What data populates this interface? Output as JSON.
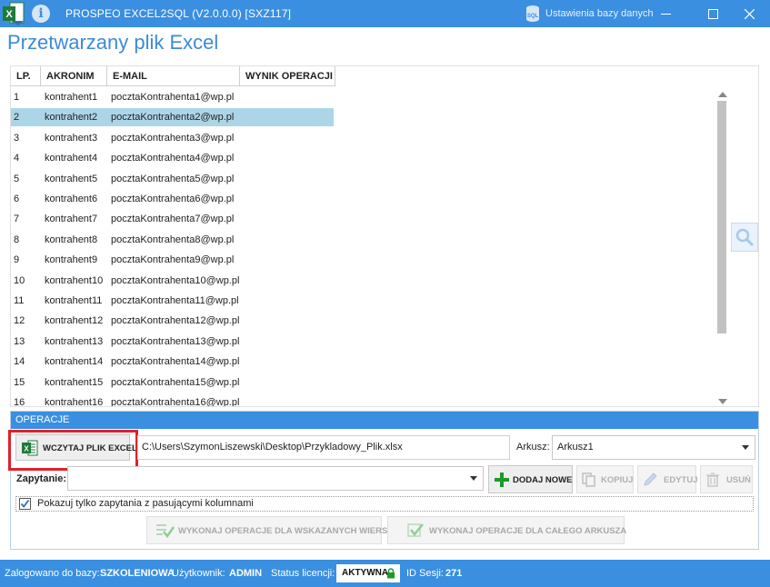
{
  "titlebar": {
    "title": "PROSPEO EXCEL2SQL (V2.0.0.0) [SXZ117]",
    "db_settings": "Ustawienia bazy danych",
    "accent": "#3a8fe0"
  },
  "page_title": "Przetwarzany plik Excel",
  "grid": {
    "columns": [
      "LP.",
      "AKRONIM",
      "E-MAIL",
      "WYNIK OPERACJI"
    ],
    "selected_row": 2,
    "selection_color": "#acd6e8",
    "rows": [
      {
        "lp": "1",
        "akronim": "kontrahent1",
        "email": "pocztaKontrahenta1@wp.pl",
        "wynik": ""
      },
      {
        "lp": "2",
        "akronim": "kontrahent2",
        "email": "pocztaKontrahenta2@wp.pl",
        "wynik": ""
      },
      {
        "lp": "3",
        "akronim": "kontrahent3",
        "email": "pocztaKontrahenta3@wp.pl",
        "wynik": ""
      },
      {
        "lp": "4",
        "akronim": "kontrahent4",
        "email": "pocztaKontrahenta4@wp.pl",
        "wynik": ""
      },
      {
        "lp": "5",
        "akronim": "kontrahent5",
        "email": "pocztaKontrahenta5@wp.pl",
        "wynik": ""
      },
      {
        "lp": "6",
        "akronim": "kontrahent6",
        "email": "pocztaKontrahenta6@wp.pl",
        "wynik": ""
      },
      {
        "lp": "7",
        "akronim": "kontrahent7",
        "email": "pocztaKontrahenta7@wp.pl",
        "wynik": ""
      },
      {
        "lp": "8",
        "akronim": "kontrahent8",
        "email": "pocztaKontrahenta8@wp.pl",
        "wynik": ""
      },
      {
        "lp": "9",
        "akronim": "kontrahent9",
        "email": "pocztaKontrahenta9@wp.pl",
        "wynik": ""
      },
      {
        "lp": "10",
        "akronim": "kontrahent10",
        "email": "pocztaKontrahenta10@wp.pl",
        "wynik": ""
      },
      {
        "lp": "11",
        "akronim": "kontrahent11",
        "email": "pocztaKontrahenta11@wp.pl",
        "wynik": ""
      },
      {
        "lp": "12",
        "akronim": "kontrahent12",
        "email": "pocztaKontrahenta12@wp.pl",
        "wynik": ""
      },
      {
        "lp": "13",
        "akronim": "kontrahent13",
        "email": "pocztaKontrahenta13@wp.pl",
        "wynik": ""
      },
      {
        "lp": "14",
        "akronim": "kontrahent14",
        "email": "pocztaKontrahenta14@wp.pl",
        "wynik": ""
      },
      {
        "lp": "15",
        "akronim": "kontrahent15",
        "email": "pocztaKontrahenta15@wp.pl",
        "wynik": ""
      },
      {
        "lp": "16",
        "akronim": "kontrahent16",
        "email": "pocztaKontrahenta16@wp.pl",
        "wynik": ""
      }
    ]
  },
  "operations": {
    "header": "OPERACJE",
    "load_excel_label": "WCZYTAJ PLIK EXCEL",
    "file_path": "C:\\Users\\SzymonLiszewski\\Desktop\\Przykladowy_Plik.xlsx",
    "sheet_label": "Arkusz:",
    "sheet_value": "Arkusz1",
    "query_label": "Zapytanie:",
    "query_value": "",
    "add_new_label": "DODAJ NOWE",
    "copy_label": "KOPIUJ",
    "edit_label": "EDYTUJ",
    "delete_label": "USUŃ",
    "filter_checkbox_label": "Pokazuj tylko zapytania z pasującymi kolumnami",
    "filter_checked": true,
    "run_selected_label": "WYKONAJ OPERACJE DLA WSKAZANYCH WIERSZY",
    "run_sheet_label": "WYKONAJ OPERACJE DLA CAŁEGO ARKUSZA",
    "highlight_color": "#e0202a"
  },
  "statusbar": {
    "db_label": "Zalogowano do bazy:",
    "db_value": "SZKOLENIOWA",
    "user_label": "Użytkownik:",
    "user_value": "ADMIN",
    "license_label": "Status licencji:",
    "license_value": "AKTYWNA",
    "session_label": "ID Sesji:",
    "session_value": "271"
  }
}
